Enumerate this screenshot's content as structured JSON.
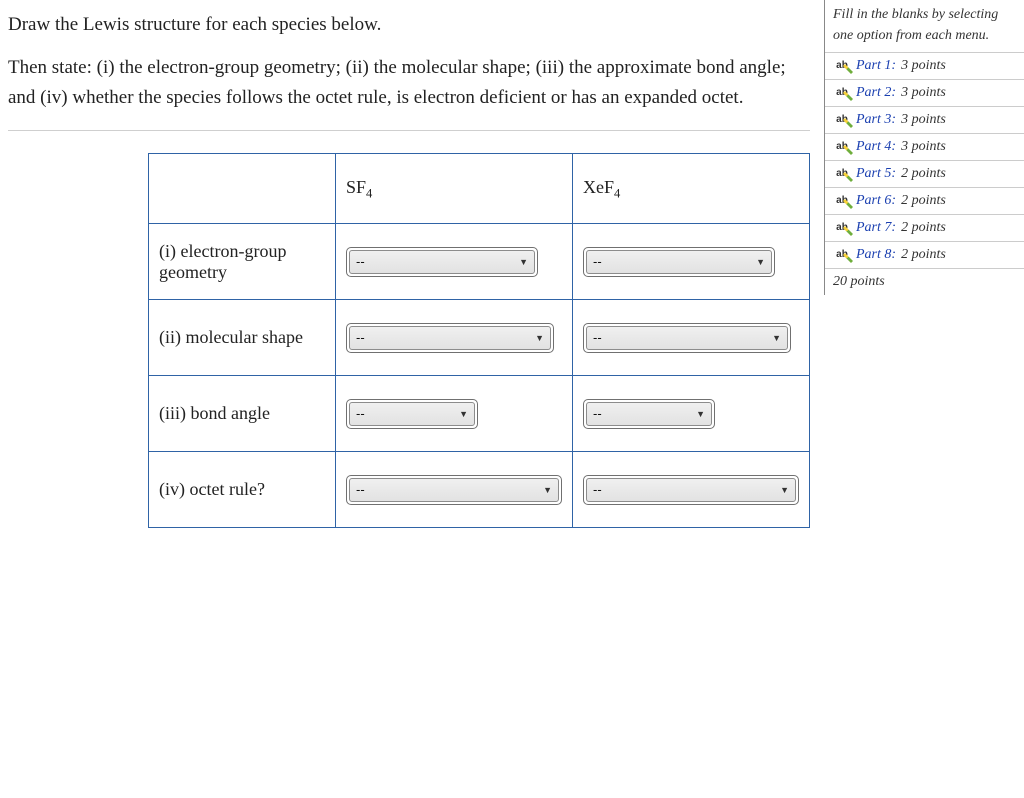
{
  "prompt": {
    "p1": "Draw the Lewis structure for each species below.",
    "p2": "Then state: (i) the electron-group geometry; (ii) the molecular shape; (iii) the approximate bond angle; and (iv) whether the species follows the octet rule, is electron deficient or has an expanded octet."
  },
  "sidebar": {
    "header": "Fill in the blanks by selecting one option from each menu.",
    "parts": [
      {
        "label": "Part 1:",
        "points": "3 points"
      },
      {
        "label": "Part 2:",
        "points": "3 points"
      },
      {
        "label": "Part 3:",
        "points": "3 points"
      },
      {
        "label": "Part 4:",
        "points": "3 points"
      },
      {
        "label": "Part 5:",
        "points": "2 points"
      },
      {
        "label": "Part 6:",
        "points": "2 points"
      },
      {
        "label": "Part 7:",
        "points": "2 points"
      },
      {
        "label": "Part 8:",
        "points": "2 points"
      }
    ],
    "total": "20 points"
  },
  "table": {
    "columns": {
      "c1_base": "SF",
      "c1_sub": "4",
      "c2_base": "XeF",
      "c2_sub": "4"
    },
    "rows": {
      "r1": "(i) electron-group geometry",
      "r2": "(ii) molecular shape",
      "r3": "(iii) bond angle",
      "r4": "(iv) octet rule?"
    },
    "placeholder": "--"
  }
}
